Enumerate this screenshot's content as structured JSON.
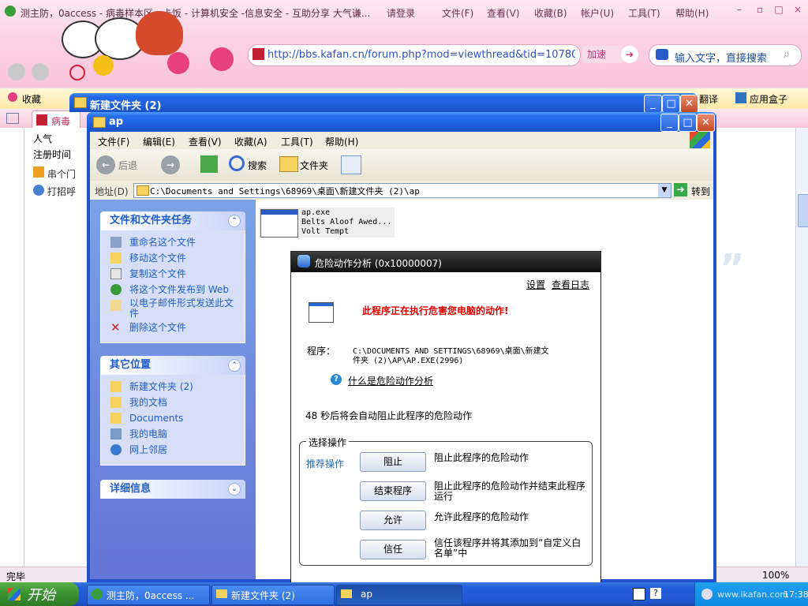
{
  "browser": {
    "title": "测主防，0access - 病毒样本区 - 卡饭 - 计算机安全 -信息安全 - 互助分享 大气谦...",
    "menu": [
      "请登录",
      "文件(F)",
      "查看(V)",
      "收藏(B)",
      "帐户(U)",
      "工具(T)",
      "帮助(H)"
    ],
    "url": "http://bbs.kafan.cn/forum.php?mod=viewthread&tid=107803",
    "accelerate": "加速",
    "search_placeholder": "输入文字，直接搜索",
    "fav_label": "收藏",
    "translate_label": "翻译",
    "app_box_label": "应用盒子",
    "tab_label": "病毒",
    "page_side": [
      "人气",
      "注册时间",
      "串个门",
      "打招呼"
    ],
    "status": "完毕",
    "zoom": "100%",
    "quote_mark": "”"
  },
  "win_back": {
    "title": "新建文件夹 (2)"
  },
  "win_front": {
    "title": "ap",
    "menu": [
      "文件(F)",
      "编辑(E)",
      "查看(V)",
      "收藏(A)",
      "工具(T)",
      "帮助(H)"
    ],
    "toolbar": {
      "back": "后退",
      "search": "搜索",
      "folders": "文件夹"
    },
    "address_label": "地址(D)",
    "address": "C:\\Documents and Settings\\68969\\桌面\\新建文件夹 (2)\\ap",
    "go": "转到",
    "tasks_title": "文件和文件夹任务",
    "tasks": [
      "重命名这个文件",
      "移动这个文件",
      "复制这个文件",
      "将这个文件发布到 Web",
      "以电子邮件形式发送此文件",
      "删除这个文件"
    ],
    "places_title": "其它位置",
    "places": [
      "新建文件夹 (2)",
      "我的文档",
      "Documents",
      "我的电脑",
      "网上邻居"
    ],
    "details_title": "详细信息",
    "file": {
      "name": "ap.exe",
      "line2": "Belts Aloof Awed...",
      "line3": "Volt Tempt"
    }
  },
  "dialog": {
    "title": "危险动作分析 (0x10000007)",
    "settings": "设置",
    "view_log": "查看日志",
    "headline": "此程序正在执行危害您电脑的动作!",
    "program_label": "程序：",
    "program_line1": "C:\\DOCUMENTS AND SETTINGS\\68969\\桌面\\新建文",
    "program_line2": "件夹 (2)\\AP\\AP.EXE(2996)",
    "what_is": "什么是危险动作分析",
    "countdown": "48 秒后将会自动阻止此程序的危险动作",
    "group_label": "选择操作",
    "recommend": "推荐操作",
    "choices": [
      {
        "button": "阻止",
        "desc": "阻止此程序的危险动作"
      },
      {
        "button": "结束程序",
        "desc": "阻止此程序的危险动作并结束此程序运行"
      },
      {
        "button": "允许",
        "desc": "允许此程序的危险动作"
      },
      {
        "button": "信任",
        "desc": "信任该程序并将其添加到“自定义白名单”中"
      }
    ]
  },
  "taskbar": {
    "start": "开始",
    "tasks": [
      "测主防，0access ...",
      "新建文件夹 (2)",
      "ap"
    ],
    "clock": "17:38",
    "watermark": "www.ikafan.com"
  },
  "colors": {
    "xp_blue": "#1f52cc",
    "headline_red": "#e00000",
    "task_link": "#215dc6"
  }
}
